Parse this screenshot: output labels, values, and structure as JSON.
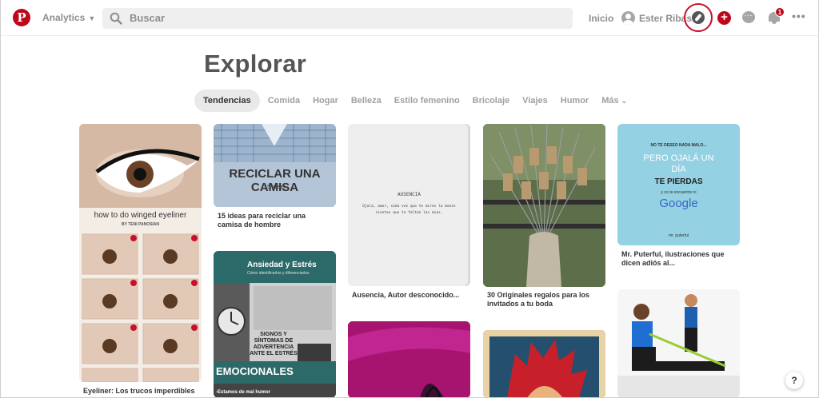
{
  "header": {
    "logo": "P",
    "analytics_label": "Analytics",
    "search_placeholder": "Buscar",
    "home_label": "Inicio",
    "user_name": "Ester Ribas",
    "notifications_count": "1",
    "brand_color": "#bd081c"
  },
  "page": {
    "title": "Explorar"
  },
  "tabs": [
    {
      "label": "Tendencias",
      "active": true
    },
    {
      "label": "Comida"
    },
    {
      "label": "Hogar"
    },
    {
      "label": "Belleza"
    },
    {
      "label": "Estilo femenino"
    },
    {
      "label": "Bricolaje"
    },
    {
      "label": "Viajes"
    },
    {
      "label": "Humor"
    },
    {
      "label": "Más"
    }
  ],
  "pins": {
    "eyeliner": {
      "overlay_title": "how to do winged eyeliner",
      "overlay_author": "BY TENI PANOSIAN",
      "caption": "Eyeliner: Los trucos imperdibles"
    },
    "camisa": {
      "overlay_title": "RECICLAR UNA CAMISA",
      "overlay_sub": "15 ideas",
      "caption": "15 ideas para reciclar una camisa de hombre"
    },
    "estres": {
      "overlay_title": "Ansiedad y Estrés",
      "overlay_sub": "Cómo identificarlos y diferenciarlos",
      "overlay_mid": "SIGNOS Y SÍNTOMAS DE ADVERTENCIA ANTE EL ESTRÉS",
      "overlay_bottom": "EMOCIONALES",
      "caption": "-Estamos de mal humor"
    },
    "ausencia": {
      "overlay_title": "AUSENCIA",
      "overlay_text": "Ojalá, amor, cada vez que te mires la manos sientas que te faltan las mías.",
      "caption": "Ausencia, Autor desconocido..."
    },
    "bengalas": {
      "caption": "30 Originales regalos para los invitados a tu boda"
    },
    "puterful": {
      "overlay_line1": "NO TE DESEO NADA MALO...",
      "overlay_line2": "PERO OJALÁ UN DÍA",
      "overlay_line3": "TE PIERDAS",
      "overlay_line4": "y no te encuentre ni",
      "overlay_google": "Google",
      "overlay_sign": "mr. puterful",
      "caption": "Mr. Puterful, ilustraciones que dicen adiós al..."
    }
  },
  "help_label": "?"
}
